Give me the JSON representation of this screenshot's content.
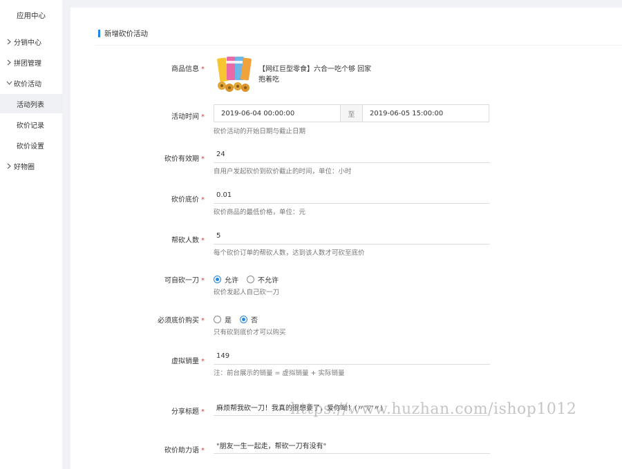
{
  "sidebar": {
    "app_title": "应用中心",
    "items": [
      {
        "label": "分销中心",
        "expanded": false
      },
      {
        "label": "拼团管理",
        "expanded": false
      },
      {
        "label": "砍价活动",
        "expanded": true
      },
      {
        "label": "好物圈",
        "expanded": false
      }
    ],
    "sub_items": [
      {
        "label": "活动列表",
        "active": true
      },
      {
        "label": "砍价记录",
        "active": false
      },
      {
        "label": "砍价设置",
        "active": false
      }
    ]
  },
  "form": {
    "section_title": "新增砍价活动",
    "required_mark": "*",
    "product": {
      "label": "商品信息",
      "name": "【网红巨型零食】六合一吃个够 回家抱着吃"
    },
    "time": {
      "label": "活动时间",
      "start": "2019-06-04 00:00:00",
      "separator": "至",
      "end": "2019-06-05 15:00:00",
      "hint": "砍价活动的开始日期与截止日期"
    },
    "validity": {
      "label": "砍价有效期",
      "value": "24",
      "hint": "自用户发起砍价到砍价截止的时间，单位：小时"
    },
    "floor_price": {
      "label": "砍价底价",
      "value": "0.01",
      "hint": "砍价商品的最低价格，单位：元"
    },
    "helpers": {
      "label": "帮砍人数",
      "value": "5",
      "hint": "每个砍价订单的帮砍人数，达到该人数才可砍至底价"
    },
    "self_cut": {
      "label": "可自砍一刀",
      "options": [
        "允许",
        "不允许"
      ],
      "selected": "允许",
      "hint": "砍价发起人自己砍一刀"
    },
    "must_floor": {
      "label": "必须底价购买",
      "options": [
        "是",
        "否"
      ],
      "selected": "否",
      "hint": "只有砍到底价才可以购买"
    },
    "virtual_sales": {
      "label": "虚拟销量",
      "value": "149",
      "hint": "注：前台展示的销量 = 虚拟销量 + 实际销量"
    },
    "share_title": {
      "label": "分享标题",
      "value": "麻烦帮我砍一刀！我真的很想要了，爱你呦！(〃'▽'〃)"
    },
    "assist_text": {
      "label": "砍价助力语",
      "value": "\"朋友一生一起走，帮砍一刀有没有\""
    }
  },
  "watermark": "https://www.huzhan.com/ishop1012",
  "colors": {
    "accent": "#1e88e5",
    "required": "#e53935",
    "background": "#f0f2f5"
  }
}
